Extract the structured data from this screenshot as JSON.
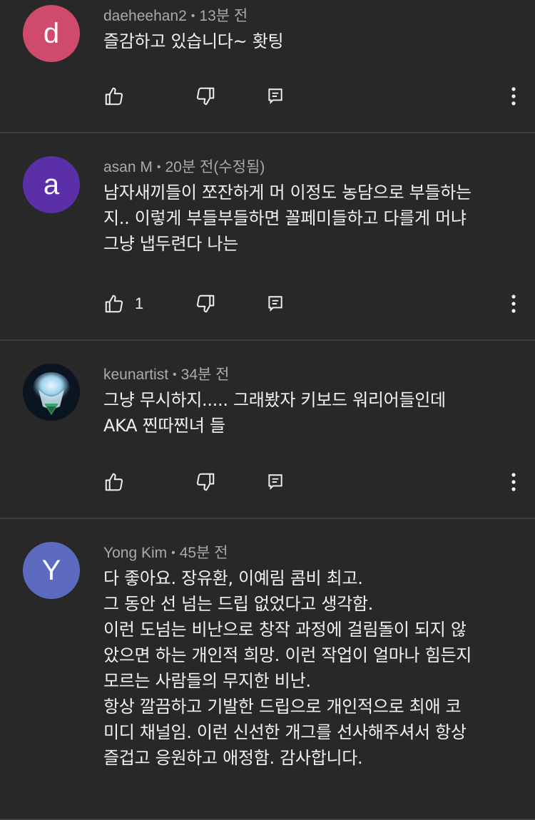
{
  "comments": [
    {
      "avatar_letter": "d",
      "avatar_color": "#d04a6e",
      "author": "daeheehan2",
      "time": "13분 전",
      "text": "즐감하고 있습니다~ 홧팅",
      "like_count": ""
    },
    {
      "avatar_letter": "a",
      "avatar_color": "#5a2fa8",
      "author": "asan M",
      "time": "20분 전(수정됨)",
      "text": "남자새끼들이 쪼잔하게 머 이정도 농담으로 부들하는\n지.. 이렇게 부들부들하면  꼴페미들하고 다를게 머냐\n그냥 냅두련다 나는",
      "like_count": "1"
    },
    {
      "avatar_letter": "",
      "avatar_color": "#0d1a2a",
      "author": "keunartist",
      "time": "34분 전",
      "text": "그냥 무시하지..... 그래봤자 키보드 워리어들인데\nAKA 찐따찐녀 들",
      "like_count": ""
    },
    {
      "avatar_letter": "Y",
      "avatar_color": "#5c6bc0",
      "author": "Yong Kim",
      "time": "45분 전",
      "text": "다 좋아요. 장유환, 이예림 콤비 최고.\n그 동안 선 넘는 드립 없었다고 생각함.\n이런 도넘는 비난으로 창작 과정에 걸림돌이 되지 않\n았으면 하는 개인적 희망. 이런 작업이 얼마나 힘든지\n모르는 사람들의 무지한 비난.\n항상 깔끔하고 기발한 드립으로 개인적으로 최애 코\n미디 채널임. 이런 신선한 개그를 선사해주셔서 항상\n즐겁고 응원하고 애정함. 감사합니다.",
      "like_count": ""
    }
  ],
  "separator": "•",
  "icons": {
    "like": "thumbs-up-icon",
    "dislike": "thumbs-down-icon",
    "reply": "reply-icon",
    "more": "more-vert-icon"
  }
}
